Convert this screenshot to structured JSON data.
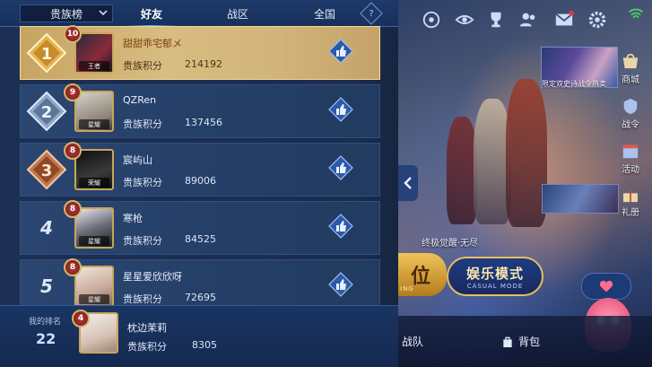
{
  "header": {
    "category_select": "贵族榜",
    "tabs": [
      {
        "label": "好友",
        "active": true
      },
      {
        "label": "战区",
        "active": false
      },
      {
        "label": "全国",
        "active": false
      }
    ],
    "help_symbol": "?"
  },
  "rows": [
    {
      "rank": "1",
      "level": "10",
      "name": "甜甜乖宅郁メ",
      "score_label": "贵族积分",
      "score": "214192",
      "avatar_tag": "王者",
      "highlight": true
    },
    {
      "rank": "2",
      "level": "9",
      "name": "QZRen",
      "score_label": "贵族积分",
      "score": "137456",
      "avatar_tag": "星耀",
      "highlight": false
    },
    {
      "rank": "3",
      "level": "8",
      "name": "宸屿山",
      "score_label": "贵族积分",
      "score": "89006",
      "avatar_tag": "荣耀",
      "highlight": false
    },
    {
      "rank": "4",
      "level": "8",
      "name": "寒枪",
      "score_label": "贵族积分",
      "score": "84525",
      "avatar_tag": "星耀",
      "highlight": false
    },
    {
      "rank": "5",
      "level": "8",
      "name": "星星爱欣欣呀",
      "score_label": "贵族积分",
      "score": "72695",
      "avatar_tag": "星耀",
      "highlight": false
    }
  ],
  "my_rank": {
    "label": "我的排名",
    "rank": "22",
    "level": "4",
    "name": "枕边茉莉",
    "score_label": "贵族积分",
    "score": "8305"
  },
  "right": {
    "promo_text": "限定双史诗战令热卖",
    "side_items": [
      {
        "label": "商城",
        "icon": "shop-icon"
      },
      {
        "label": "战令",
        "icon": "battle-pass-icon"
      },
      {
        "label": "活动",
        "icon": "event-icon"
      },
      {
        "label": "礼册",
        "icon": "gift-icon"
      }
    ],
    "scene_caption": "终极觉醒·无尽",
    "rank_mode": {
      "big": "位",
      "small": "ING"
    },
    "fun_mode": {
      "big": "娱乐模式",
      "small": "CASUAL MODE"
    },
    "bottom_tabs": [
      {
        "label": "战队",
        "icon": "team-icon"
      },
      {
        "label": "背包",
        "icon": "backpack-icon"
      }
    ],
    "top_icons": [
      "record-icon",
      "eye-icon",
      "trophy-icon",
      "friends-icon",
      "mail-icon",
      "settings-icon"
    ]
  },
  "colors": {
    "panel_bg": "#1d2f52",
    "highlight_gold": "#d8bc80",
    "accent_blue": "#59b6ff",
    "level_red": "#b93b3b"
  }
}
